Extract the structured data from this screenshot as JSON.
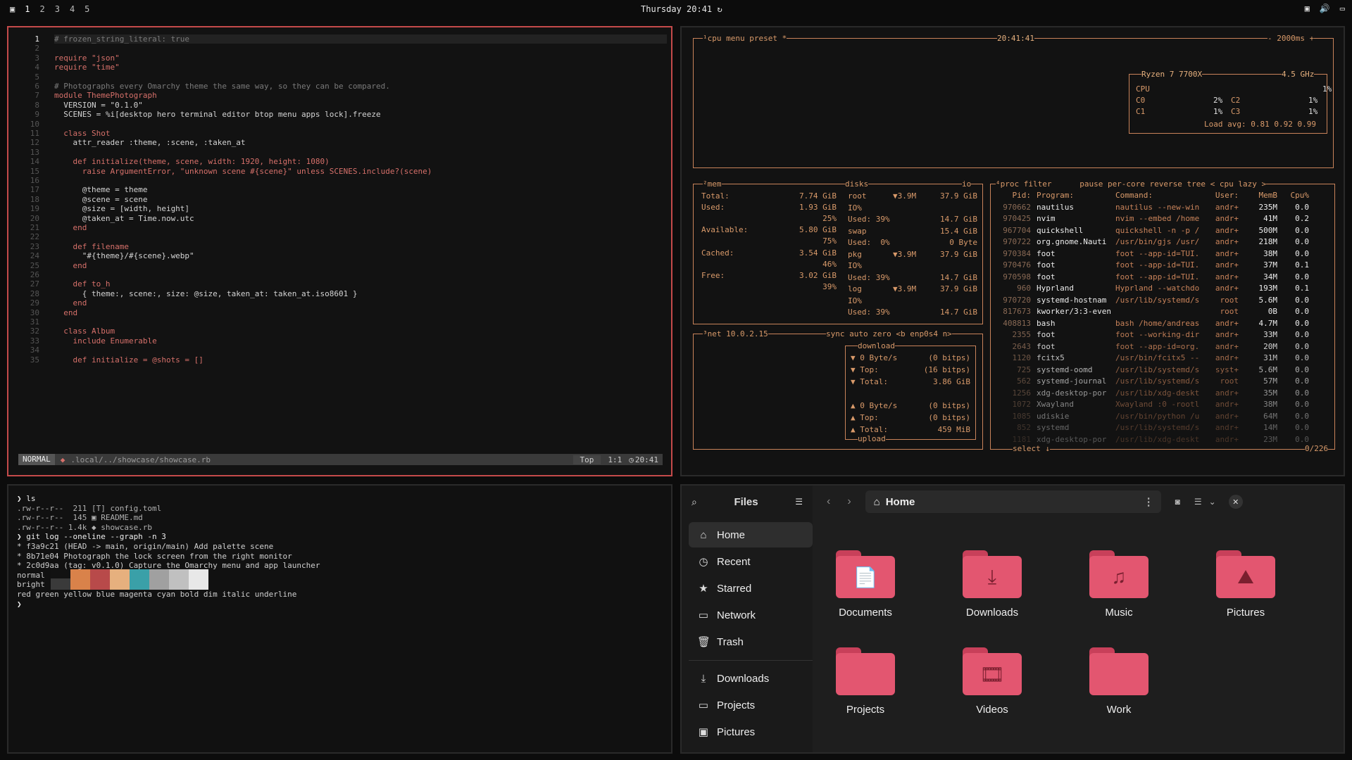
{
  "topbar": {
    "workspaces": [
      "1",
      "2",
      "3",
      "4",
      "5"
    ],
    "clock": "Thursday 20:41"
  },
  "nvim": {
    "lines": [
      "# frozen_string_literal: true",
      "",
      "require \"json\"",
      "require \"time\"",
      "",
      "# Photographs every Omarchy theme the same way, so they can be compared.",
      "module ThemePhotograph",
      "  VERSION = \"0.1.0\"",
      "  SCENES = %i[desktop hero terminal editor btop menu apps lock].freeze",
      "",
      "  class Shot",
      "    attr_reader :theme, :scene, :taken_at",
      "",
      "    def initialize(theme, scene, width: 1920, height: 1080)",
      "      raise ArgumentError, \"unknown scene #{scene}\" unless SCENES.include?(scene)",
      "",
      "      @theme = theme",
      "      @scene = scene",
      "      @size = [width, height]",
      "      @taken_at = Time.now.utc",
      "    end",
      "",
      "    def filename",
      "      \"#{theme}/#{scene}.webp\"",
      "    end",
      "",
      "    def to_h",
      "      { theme:, scene:, size: @size, taken_at: taken_at.iso8601 }",
      "    end",
      "  end",
      "",
      "  class Album",
      "    include Enumerable",
      "",
      "    def initialize = @shots = []"
    ],
    "status": {
      "mode": "NORMAL",
      "path": ".local/../showcase/showcase.rb",
      "pos": "Top",
      "cursor": "1:1",
      "time": "20:41"
    }
  },
  "terminal": {
    "lines": [
      "❯ ls",
      ".rw-r--r--  211 [T] config.toml",
      ".rw-r--r--  145 ▣ README.md",
      ".rw-r--r-- 1.4k ◆ showcase.rb",
      "❯ git log --oneline --graph -n 3",
      "* f3a9c21 (HEAD -> main, origin/main) Add palette scene",
      "* 8b71e04 Photograph the lock screen from the right monitor",
      "* 2c0d9aa (tag: v0.1.0) Capture the Omarchy menu and app launcher",
      "normal",
      "bright",
      "red green yellow blue magenta cyan bold dim italic underline",
      "❯"
    ],
    "palette_normal": [
      "#121212",
      "#d9824a",
      "#b84a4a",
      "#e6b07e",
      "#3aa0a8",
      "#a0a0a0",
      "#c0c0c0",
      "#e8e8e8"
    ],
    "palette_bright": [
      "#3a3a3a",
      "#d9824a",
      "#b84a4a",
      "#e6b07e",
      "#3aa0a8",
      "#a0a0a0",
      "#c0c0c0",
      "#e8e8e8"
    ]
  },
  "btop": {
    "cpu_header": "¹cpu menu preset *",
    "time": "20:41:41",
    "interval": "- 2000ms +",
    "cpu_model": "Ryzen 7 7700X",
    "cpu_freq": "4.5 GHz",
    "cpu_rows": [
      [
        "CPU",
        "1%"
      ],
      [
        "C0",
        "2%"
      ],
      [
        "C2",
        "1%"
      ],
      [
        "C1",
        "1%"
      ],
      [
        "C3",
        "1%"
      ]
    ],
    "load_avg": "Load avg: 0.81 0.92 0.99",
    "mem": {
      "title": "²mem",
      "total": "7.74 GiB",
      "used": "1.93 GiB",
      "used_pct": "25%",
      "available": "5.80 GiB",
      "available_pct": "75%",
      "cached": "3.54 GiB",
      "cached_pct": "46%",
      "free": "3.02 GiB",
      "free_pct": "39%"
    },
    "disks": {
      "title": "disks",
      "rows": [
        [
          "root",
          "▼3.9M",
          "37.9 GiB"
        ],
        [
          "IO%",
          ""
        ],
        [
          "Used: 39%",
          "14.7 GiB"
        ],
        [
          "swap",
          "",
          "15.4 GiB"
        ],
        [
          "Used:  0%",
          "0 Byte"
        ],
        [
          "pkg",
          "▼3.9M",
          "37.9 GiB"
        ],
        [
          "IO%",
          ""
        ],
        [
          "Used: 39%",
          "14.7 GiB"
        ],
        [
          "log",
          "▼3.9M",
          "37.9 GiB"
        ],
        [
          "IO%",
          ""
        ],
        [
          "Used: 39%",
          "14.7 GiB"
        ]
      ]
    },
    "net": {
      "title": "³net 10.0.2.15",
      "header": "sync auto zero <b enp0s4 n>",
      "download": "download",
      "upload": "upload",
      "rows": [
        [
          "▼ 0 Byte/s",
          "(0 bitps)"
        ],
        [
          "▼ Top:",
          "(16 bitps)"
        ],
        [
          "▼ Total:",
          "3.86 GiB"
        ],
        [
          "▲ 0 Byte/s",
          "(0 bitps)"
        ],
        [
          "▲ Top:",
          "(0 bitps)"
        ],
        [
          "▲ Total:",
          "459 MiB"
        ]
      ]
    },
    "proc": {
      "header": "⁴proc filter      pause per-core reverse tree < cpu lazy >",
      "columns": [
        "Pid:",
        "Program:",
        "Command:",
        "User:",
        "MemB",
        "Cpu%"
      ],
      "rows": [
        [
          "970662",
          "nautilus",
          "nautilus --new-win",
          "andr+",
          "235M",
          "0.0"
        ],
        [
          "970425",
          "nvim",
          "nvim --embed /home",
          "andr+",
          "41M",
          "0.2"
        ],
        [
          "967704",
          "quickshell",
          "quickshell -n -p /",
          "andr+",
          "500M",
          "0.0"
        ],
        [
          "970722",
          "org.gnome.Nauti",
          "/usr/bin/gjs /usr/",
          "andr+",
          "218M",
          "0.0"
        ],
        [
          "970384",
          "foot",
          "foot --app-id=TUI.",
          "andr+",
          "38M",
          "0.0"
        ],
        [
          "970476",
          "foot",
          "foot --app-id=TUI.",
          "andr+",
          "37M",
          "0.1"
        ],
        [
          "970598",
          "foot",
          "foot --app-id=TUI.",
          "andr+",
          "34M",
          "0.0"
        ],
        [
          "960",
          "Hyprland",
          "Hyprland --watchdo",
          "andr+",
          "193M",
          "0.1"
        ],
        [
          "970720",
          "systemd-hostnam",
          "/usr/lib/systemd/s",
          "root",
          "5.6M",
          "0.0"
        ],
        [
          "817673",
          "kworker/3:3-even",
          "",
          "root",
          "0B",
          "0.0"
        ],
        [
          "408813",
          "bash",
          "bash /home/andreas",
          "andr+",
          "4.7M",
          "0.0"
        ],
        [
          "2355",
          "foot",
          "foot --working-dir",
          "andr+",
          "33M",
          "0.0"
        ],
        [
          "2643",
          "foot",
          "foot --app-id=org.",
          "andr+",
          "20M",
          "0.0"
        ],
        [
          "1120",
          "fcitx5",
          "/usr/bin/fcitx5 --",
          "andr+",
          "31M",
          "0.0"
        ],
        [
          "725",
          "systemd-oomd",
          "/usr/lib/systemd/s",
          "syst+",
          "5.6M",
          "0.0"
        ],
        [
          "562",
          "systemd-journal",
          "/usr/lib/systemd/s",
          "root",
          "57M",
          "0.0"
        ],
        [
          "1256",
          "xdg-desktop-por",
          "/usr/lib/xdg-deskt",
          "andr+",
          "35M",
          "0.0"
        ],
        [
          "1072",
          "Xwayland",
          "Xwayland :0 -rootl",
          "andr+",
          "38M",
          "0.0"
        ],
        [
          "1085",
          "udiskie",
          "/usr/bin/python /u",
          "andr+",
          "64M",
          "0.0"
        ],
        [
          "852",
          "systemd",
          "/usr/lib/systemd/s",
          "andr+",
          "14M",
          "0.0"
        ],
        [
          "1181",
          "xdg-desktop-por",
          "/usr/lib/xdg-deskt",
          "andr+",
          "23M",
          "0.0"
        ]
      ],
      "footer_left": "select ↓",
      "footer_right": "0/226"
    }
  },
  "files": {
    "sidebar_title": "Files",
    "path": "Home",
    "sidebar": [
      "Home",
      "Recent",
      "Starred",
      "Network",
      "Trash"
    ],
    "places": [
      "Downloads",
      "Projects",
      "Pictures"
    ],
    "folders": [
      "Documents",
      "Downloads",
      "Music",
      "Pictures",
      "Projects",
      "Videos",
      "Work"
    ]
  }
}
